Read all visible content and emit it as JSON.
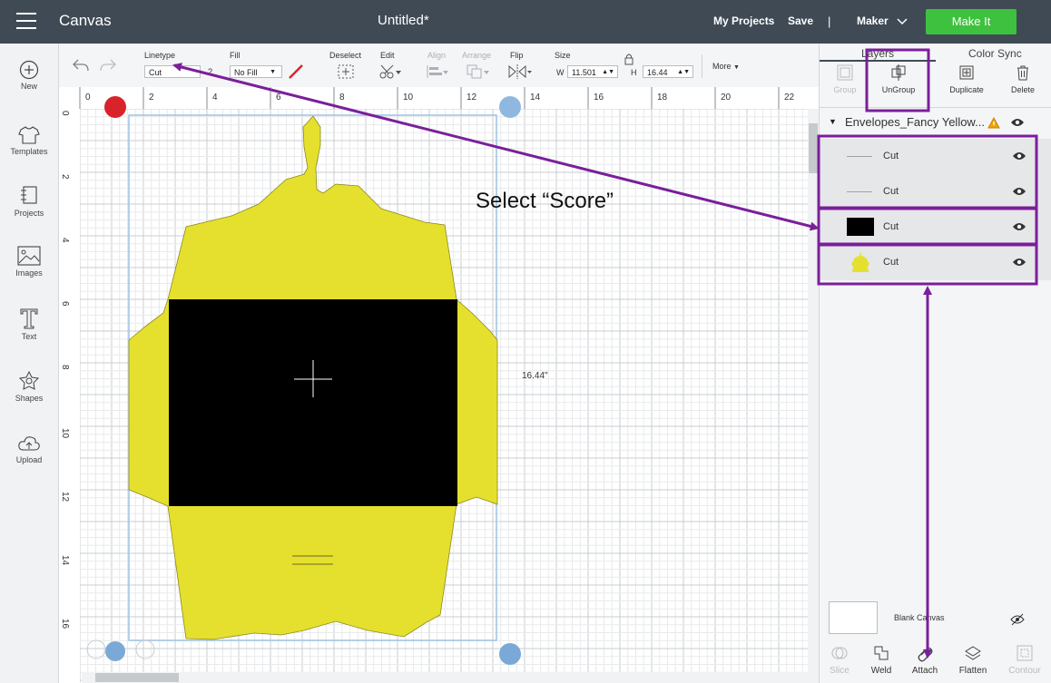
{
  "header": {
    "app_name": "Canvas",
    "document_title": "Untitled*",
    "my_projects": "My Projects",
    "save": "Save",
    "separator": "|",
    "machine": "Maker",
    "make_it": "Make It"
  },
  "sidebar": {
    "items": [
      {
        "label": "New",
        "icon": "plus-circle-icon"
      },
      {
        "label": "Templates",
        "icon": "tshirt-icon"
      },
      {
        "label": "Projects",
        "icon": "projects-icon"
      },
      {
        "label": "Images",
        "icon": "image-icon"
      },
      {
        "label": "Text",
        "icon": "text-icon"
      },
      {
        "label": "Shapes",
        "icon": "shapes-icon"
      },
      {
        "label": "Upload",
        "icon": "upload-icon"
      }
    ]
  },
  "toolbar": {
    "linetype_label": "Linetype",
    "linetype_value": "Cut",
    "fill_label": "Fill",
    "fill_value": "No Fill",
    "deselect_label": "Deselect",
    "edit_label": "Edit",
    "align_label": "Align",
    "arrange_label": "Arrange",
    "flip_label": "Flip",
    "size_label": "Size",
    "w_label": "W",
    "w_value": "11.501",
    "h_label": "H",
    "h_value": "16.44",
    "more_label": "More",
    "help_mark": "?"
  },
  "canvas": {
    "ruler_top": [
      "0",
      "2",
      "4",
      "6",
      "8",
      "10",
      "12",
      "14",
      "16",
      "18",
      "20",
      "22"
    ],
    "ruler_left": [
      "0",
      "2",
      "4",
      "6",
      "8",
      "10",
      "12",
      "14",
      "16"
    ],
    "dimension_label": "16.44\"",
    "annotation_text": "Select “Score”"
  },
  "right_panel": {
    "tabs": [
      "Layers",
      "Color Sync"
    ],
    "actions": [
      "Group",
      "UnGroup",
      "Duplicate",
      "Delete"
    ],
    "group_name": "Envelopes_Fancy Yellow...",
    "layers": [
      {
        "label": "Cut",
        "swatch": "line"
      },
      {
        "label": "Cut",
        "swatch": "line"
      },
      {
        "label": "Cut",
        "swatch": "black"
      },
      {
        "label": "Cut",
        "swatch": "yellow"
      }
    ],
    "blank_canvas": "Blank Canvas",
    "bottom_actions": [
      "Slice",
      "Weld",
      "Attach",
      "Flatten",
      "Contour"
    ]
  },
  "colors": {
    "header_bg": "#3f4a55",
    "accent_green": "#3ec13e",
    "envelope_yellow": "#e5e02e",
    "highlight_purple": "#7a1f9a",
    "pen_red": "#d8232a"
  }
}
